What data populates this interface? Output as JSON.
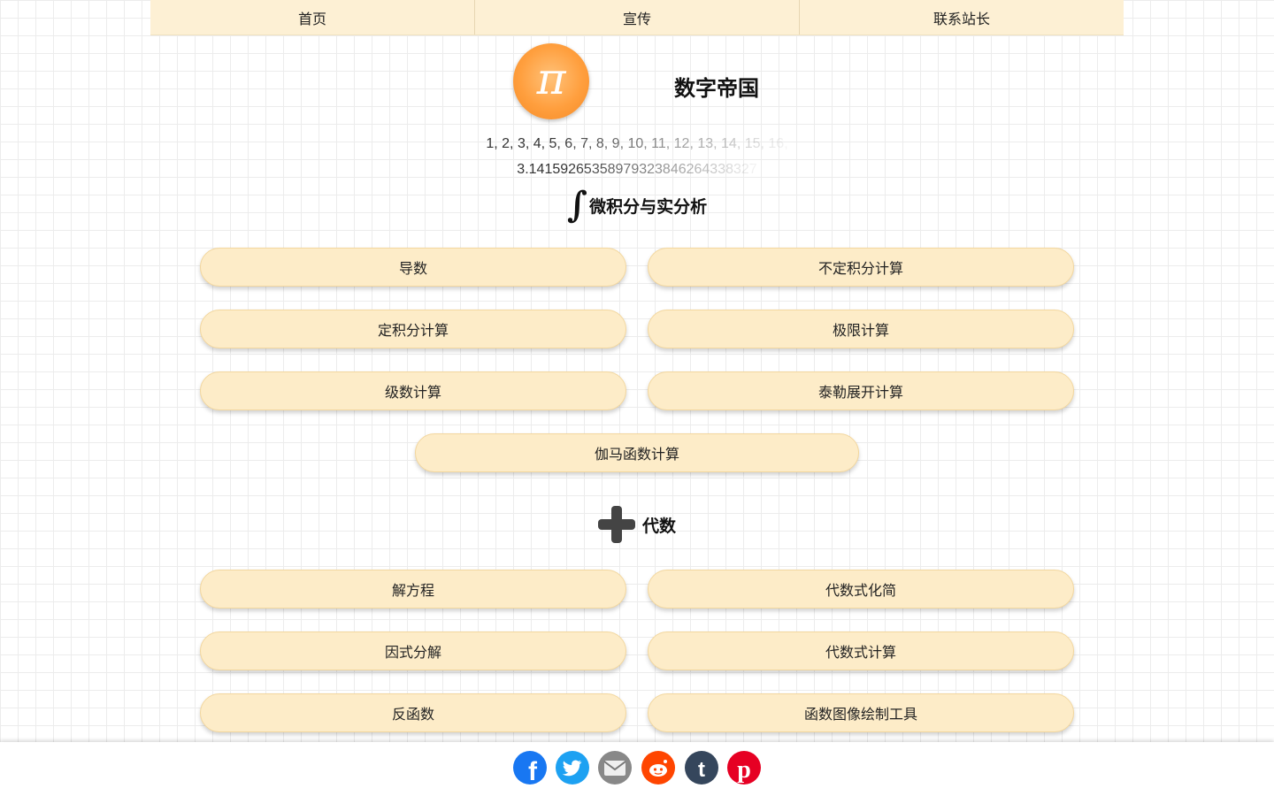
{
  "nav": {
    "items": [
      {
        "label": "首页"
      },
      {
        "label": "宣传"
      },
      {
        "label": "联系站长"
      }
    ]
  },
  "header": {
    "logo_symbol": "π",
    "site_title": "数字帝国",
    "sequence_naturals": "1, 2, 3, 4, 5, 6, 7, 8, 9, 10, 11, 12, 13, 14, 15, 16,",
    "sequence_pi": "3.14159265358979323846264338327"
  },
  "sections": {
    "calculus": {
      "icon": "integral-icon",
      "icon_glyph": "∫",
      "title": "微积分与实分析",
      "buttons": [
        {
          "label": "导数"
        },
        {
          "label": "不定积分计算"
        },
        {
          "label": "定积分计算"
        },
        {
          "label": "极限计算"
        },
        {
          "label": "级数计算"
        },
        {
          "label": "泰勒展开计算"
        },
        {
          "label": "伽马函数计算"
        }
      ]
    },
    "algebra": {
      "icon": "plus-icon",
      "title": "代数",
      "buttons": [
        {
          "label": "解方程"
        },
        {
          "label": "代数式化简"
        },
        {
          "label": "因式分解"
        },
        {
          "label": "代数式计算"
        },
        {
          "label": "反函数"
        },
        {
          "label": "函数图像绘制工具"
        }
      ]
    }
  },
  "share": {
    "icons": [
      "facebook-icon",
      "twitter-icon",
      "email-icon",
      "reddit-icon",
      "tumblr-icon",
      "pinterest-icon"
    ],
    "colors": {
      "facebook": "#1877f2",
      "twitter": "#1da1f2",
      "email": "#888888",
      "reddit": "#ff4500",
      "tumblr": "#35465c",
      "pinterest": "#e60023"
    }
  },
  "colors": {
    "nav_bg": "#fdf0d4",
    "button_bg": "#fdecc8",
    "logo_orange": "#ff9f3e"
  }
}
